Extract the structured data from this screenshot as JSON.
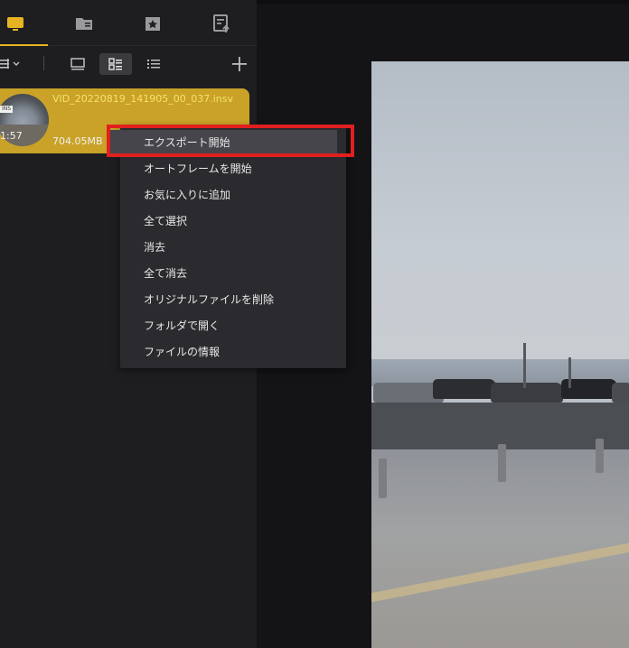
{
  "file": {
    "name": "VID_20220819_141905_00_037.insv",
    "duration": "1:57",
    "size": "704.05MB",
    "badge": "INS"
  },
  "context_menu": {
    "items": [
      {
        "label": "エクスポート開始",
        "highlighted": true
      },
      {
        "label": "オートフレームを開始"
      },
      {
        "label": "お気に入りに追加"
      },
      {
        "label": "全て選択"
      },
      {
        "label": "消去"
      },
      {
        "label": "全て消去"
      },
      {
        "label": "オリジナルファイルを削除"
      },
      {
        "label": "フォルダで開く"
      },
      {
        "label": "ファイルの情報"
      }
    ]
  },
  "tabs": [
    "monitor-icon",
    "folder-icon",
    "favorites-icon",
    "export-list-icon"
  ],
  "colors": {
    "accent": "#e6b422",
    "card": "#c9a227",
    "callout": "#e0201e"
  }
}
